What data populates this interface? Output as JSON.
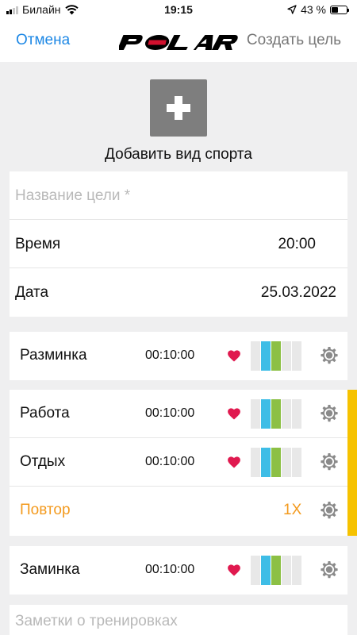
{
  "status_bar": {
    "carrier": "Билайн",
    "time": "19:15",
    "battery_text": "43 %",
    "battery_level": 0.43
  },
  "nav": {
    "cancel": "Отмена",
    "logo": "POLAR",
    "title": "Создать цель"
  },
  "add_sport": {
    "label": "Добавить вид спорта"
  },
  "form": {
    "name_placeholder": "Название цели *",
    "time_label": "Время",
    "time_value": "20:00",
    "date_label": "Дата",
    "date_value": "25.03.2022"
  },
  "phases": {
    "warmup": {
      "label": "Разминка",
      "time": "00:10:00"
    },
    "work": {
      "label": "Работа",
      "time": "00:10:00"
    },
    "rest": {
      "label": "Отдых",
      "time": "00:10:00"
    },
    "repeat": {
      "label": "Повтор",
      "count": "1X"
    },
    "cooldown": {
      "label": "Заминка",
      "time": "00:10:00"
    }
  },
  "notes": {
    "placeholder": "Заметки о тренировках"
  },
  "colors": {
    "accent": "#1e88e5",
    "repeat": "#f39a1e",
    "repeat_bar": "#f6c200",
    "heart": "#e0194f",
    "zone_blue": "#3ebde6",
    "zone_green": "#8cc045"
  },
  "icons": {
    "heart": "heart-icon",
    "settings": "gear-icon",
    "wifi": "wifi-icon",
    "location": "location-arrow-icon",
    "add": "plus-icon"
  }
}
